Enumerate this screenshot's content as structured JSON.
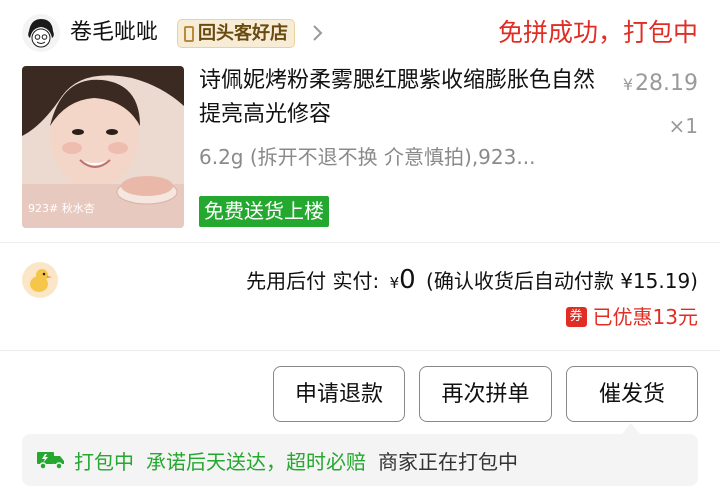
{
  "shop": {
    "name": "卷毛呲呲",
    "badge": "回头客好店"
  },
  "order": {
    "status": "免拼成功，打包中"
  },
  "product": {
    "title": "诗佩妮烤粉柔雾腮红腮紫收缩膨胀色自然提亮高光修容",
    "spec": "6.2g (拆开不退不换 介意慎拍),923...",
    "delivery_tag": "免费送货上楼",
    "price_symbol": "¥",
    "price": "28.19",
    "quantity": "×1",
    "image_caption": "923# 秋水杏"
  },
  "payment": {
    "label": "先用后付 实付:",
    "currency": "¥",
    "paid_amount": "0",
    "note": "(确认收货后自动付款 ¥15.19)",
    "coupon_icon": "券",
    "discount": "已优惠13元"
  },
  "actions": {
    "refund": "申请退款",
    "regroup": "再次拼单",
    "urge": "催发货"
  },
  "progress": {
    "icon": "delivery-truck-icon",
    "status": "打包中",
    "promise": "承诺后天送达，超时必赔",
    "detail": "商家正在打包中"
  },
  "colors": {
    "accent_red": "#e02e24",
    "accent_green": "#25a82f",
    "badge_gold": "#f7edd6"
  }
}
